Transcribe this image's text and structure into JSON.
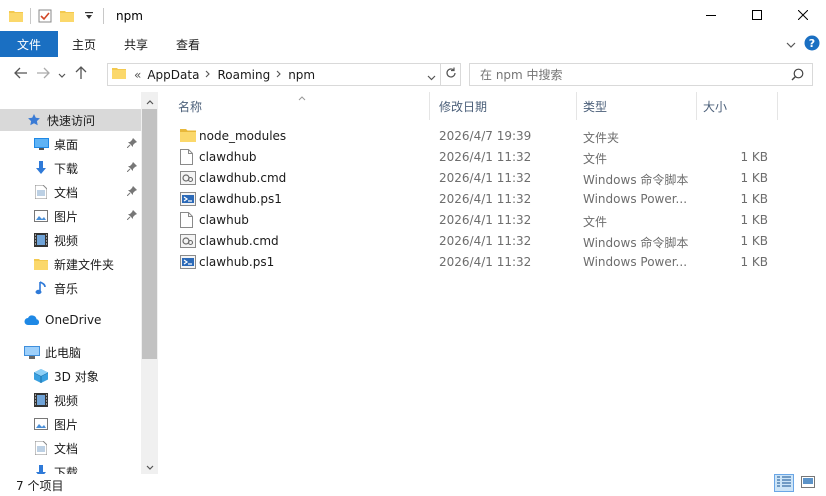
{
  "window": {
    "title": "npm",
    "controls": {
      "minimize_icon": "minimize-icon",
      "maximize_icon": "maximize-icon",
      "close_icon": "close-icon"
    }
  },
  "ribbon": {
    "tabs": [
      {
        "label": "文件",
        "active": true
      },
      {
        "label": "主页"
      },
      {
        "label": "共享"
      },
      {
        "label": "查看"
      }
    ],
    "accent": "#1a6fc2"
  },
  "address": {
    "overflow": "«",
    "crumbs": [
      "AppData",
      "Roaming",
      "npm"
    ]
  },
  "search": {
    "placeholder": "在 npm 中搜索"
  },
  "nav": {
    "items": [
      {
        "label": "快速访问",
        "icon": "star-icon",
        "selected": true
      },
      {
        "label": "桌面",
        "icon": "desktop-icon",
        "pinned": true
      },
      {
        "label": "下载",
        "icon": "download-icon",
        "pinned": true
      },
      {
        "label": "文档",
        "icon": "document-icon",
        "pinned": true
      },
      {
        "label": "图片",
        "icon": "pictures-icon",
        "pinned": true
      },
      {
        "label": "视频",
        "icon": "video-icon"
      },
      {
        "label": "新建文件夹",
        "icon": "folder-icon"
      },
      {
        "label": "音乐",
        "icon": "music-icon"
      },
      {
        "label": "OneDrive",
        "icon": "cloud-icon"
      },
      {
        "label": "此电脑",
        "icon": "computer-icon"
      },
      {
        "label": "3D 对象",
        "icon": "cube-icon"
      },
      {
        "label": "视频",
        "icon": "video-icon"
      },
      {
        "label": "图片",
        "icon": "pictures-icon"
      },
      {
        "label": "文档",
        "icon": "document-icon"
      },
      {
        "label": "下载",
        "icon": "download-icon"
      }
    ]
  },
  "columns": {
    "name": "名称",
    "date": "修改日期",
    "type": "类型",
    "size": "大小"
  },
  "files": [
    {
      "name": "node_modules",
      "date": "2026/4/7 19:39",
      "type": "文件夹",
      "size": "",
      "icon": "folder-icon"
    },
    {
      "name": "clawdhub",
      "date": "2026/4/1 11:32",
      "type": "文件",
      "size": "1 KB",
      "icon": "file-icon"
    },
    {
      "name": "clawdhub.cmd",
      "date": "2026/4/1 11:32",
      "type": "Windows 命令脚本",
      "size": "1 KB",
      "icon": "cmd-file-icon"
    },
    {
      "name": "clawdhub.ps1",
      "date": "2026/4/1 11:32",
      "type": "Windows Power...",
      "size": "1 KB",
      "icon": "powershell-file-icon"
    },
    {
      "name": "clawhub",
      "date": "2026/4/1 11:32",
      "type": "文件",
      "size": "1 KB",
      "icon": "file-icon"
    },
    {
      "name": "clawhub.cmd",
      "date": "2026/4/1 11:32",
      "type": "Windows 命令脚本",
      "size": "1 KB",
      "icon": "cmd-file-icon"
    },
    {
      "name": "clawhub.ps1",
      "date": "2026/4/1 11:32",
      "type": "Windows Power...",
      "size": "1 KB",
      "icon": "powershell-file-icon"
    }
  ],
  "status": {
    "count": "7 个项目"
  }
}
